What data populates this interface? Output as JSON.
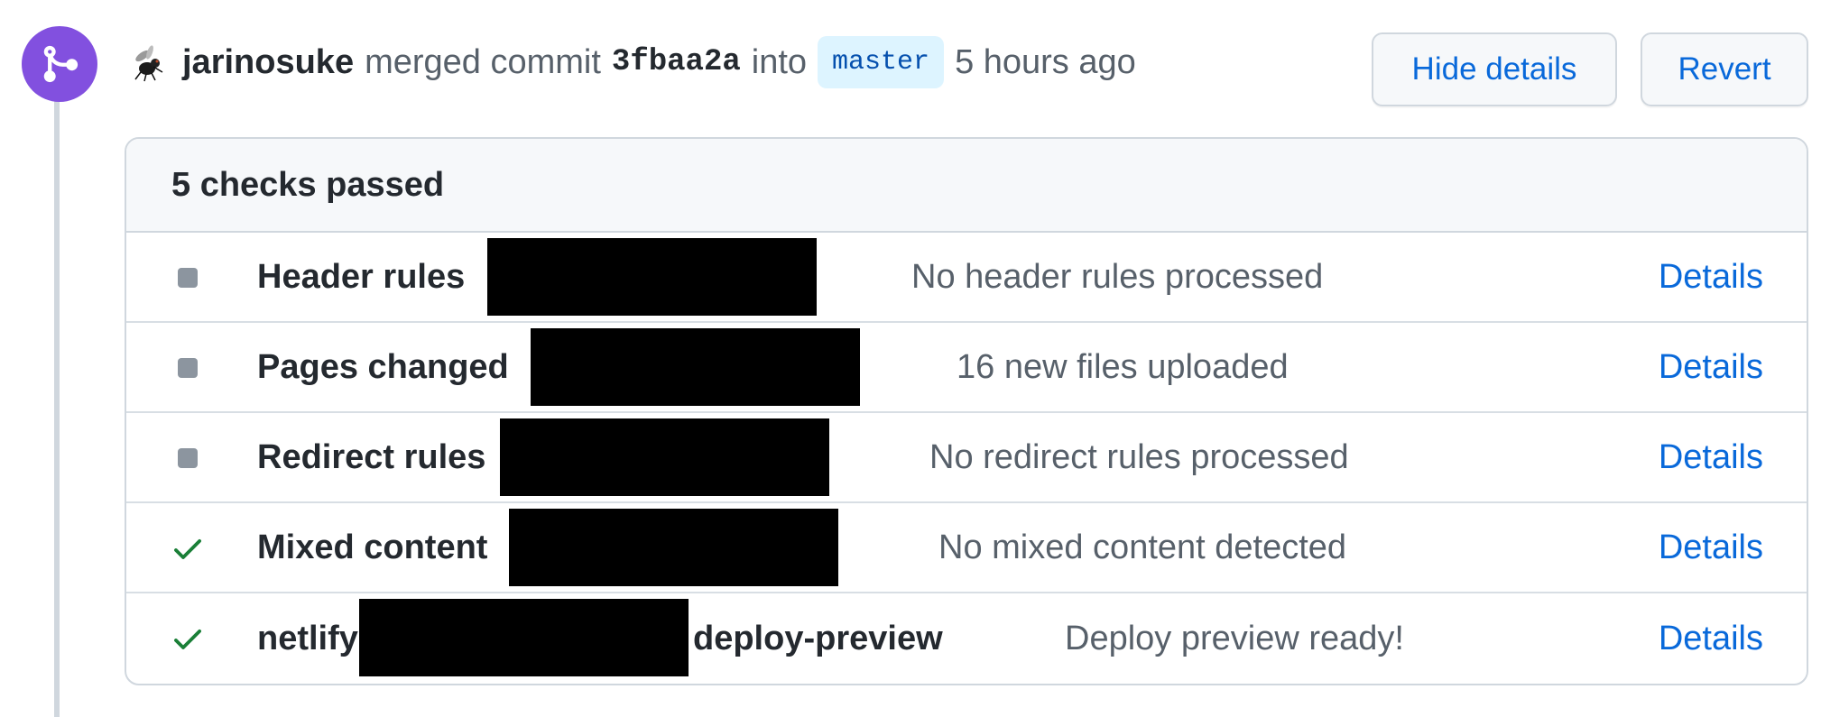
{
  "event": {
    "author": "jarinosuke",
    "action": "merged commit",
    "commit_sha": "3fbaa2a",
    "into_text": "into",
    "branch": "master",
    "time": "5 hours ago",
    "hide_details_label": "Hide details",
    "revert_label": "Revert"
  },
  "colors": {
    "accent": "#0969da",
    "merged_purple": "#8250df",
    "success_green": "#1a7f37",
    "neutral_gray": "#8c959f"
  },
  "checks": {
    "summary": "5 checks passed",
    "items": [
      {
        "status": "neutral",
        "status_icon": "square-icon",
        "name": "Header rules",
        "description": "No header rules processed",
        "details": "Details"
      },
      {
        "status": "neutral",
        "status_icon": "square-icon",
        "name": "Pages changed",
        "description": "16 new files uploaded",
        "details": "Details"
      },
      {
        "status": "neutral",
        "status_icon": "square-icon",
        "name": "Redirect rules",
        "description": "No redirect rules processed",
        "details": "Details"
      },
      {
        "status": "success",
        "status_icon": "check-icon",
        "name": "Mixed content",
        "description": "No mixed content detected",
        "details": "Details"
      },
      {
        "status": "success",
        "status_icon": "check-icon",
        "name": "netlify",
        "name_suffix": "deploy-preview",
        "description": "Deploy preview ready!",
        "details": "Details"
      }
    ]
  }
}
